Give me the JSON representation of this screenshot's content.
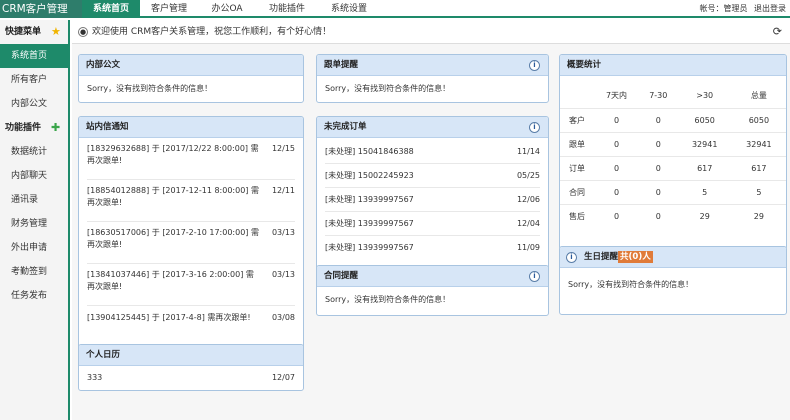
{
  "app": {
    "title": "CRM客户管理"
  },
  "nav": {
    "items": [
      {
        "label": "系统首页",
        "active": true
      },
      {
        "label": "客户管理"
      },
      {
        "label": "办公OA"
      },
      {
        "label": "功能插件"
      },
      {
        "label": "系统设置"
      }
    ],
    "account": "帐号：管理员",
    "logout": "退出登录"
  },
  "sidebar": {
    "quick_title": "快捷菜单",
    "quick_items": [
      {
        "label": "系统首页",
        "active": true
      },
      {
        "label": "所有客户"
      },
      {
        "label": "内部公文"
      }
    ],
    "plugin_title": "功能插件",
    "plugin_items": [
      {
        "label": "数据统计"
      },
      {
        "label": "内部聊天"
      },
      {
        "label": "通讯录"
      },
      {
        "label": "财务管理"
      },
      {
        "label": "外出申请"
      },
      {
        "label": "考勤签到"
      },
      {
        "label": "任务发布"
      }
    ]
  },
  "welcome": {
    "text": "欢迎使用 CRM客户关系管理，祝您工作顺利，有个好心情！"
  },
  "empty_msg": "Sorry，没有找到符合条件的信息！",
  "panels": {
    "docs": {
      "title": "内部公文"
    },
    "followup": {
      "title": "跟单提醒"
    },
    "messages": {
      "title": "站内信通知",
      "items": [
        {
          "text": "[18329632688] 于 [2017/12/22 8:00:00] 需再次跟单!",
          "date": "12/15"
        },
        {
          "text": "[18854012888] 于 [2017-12-11 8:00:00] 需再次跟单!",
          "date": "12/11"
        },
        {
          "text": "[18630517006] 于 [2017-2-10 17:00:00] 需再次跟单!",
          "date": "03/13"
        },
        {
          "text": "[13841037446] 于 [2017-3-16 2:00:00] 需再次跟单!",
          "date": "03/13"
        },
        {
          "text": "[13904125445] 于 [2017-4-8] 需再次跟单!",
          "date": "03/08"
        }
      ]
    },
    "orders": {
      "title": "未完成订单",
      "items": [
        {
          "text": "[未处理] 15041846388",
          "date": "11/14"
        },
        {
          "text": "[未处理] 15002245923",
          "date": "05/25"
        },
        {
          "text": "[未处理] 13939997567",
          "date": "12/06"
        },
        {
          "text": "[未处理] 13939997567",
          "date": "12/04"
        },
        {
          "text": "[未处理] 13939997567",
          "date": "11/09"
        }
      ]
    },
    "contracts": {
      "title": "合同提醒"
    },
    "calendar": {
      "title": "个人日历",
      "items": [
        {
          "text": "333",
          "date": "12/07"
        }
      ]
    },
    "stats": {
      "title": "概要统计",
      "headers": [
        "",
        "7天内",
        "7-30",
        ">30",
        "总量"
      ],
      "rows": [
        [
          "客户",
          "0",
          "0",
          "6050",
          "6050"
        ],
        [
          "跟单",
          "0",
          "0",
          "32941",
          "32941"
        ],
        [
          "订单",
          "0",
          "0",
          "617",
          "617"
        ],
        [
          "合同",
          "0",
          "0",
          "5",
          "5"
        ],
        [
          "售后",
          "0",
          "0",
          "29",
          "29"
        ]
      ]
    },
    "birthday": {
      "title": "生日提醒",
      "badge": "共(0)人"
    }
  },
  "colors": {
    "brand": "#2e7d6b",
    "accent": "#1e8a6a",
    "panel_header": "#d7e6f7",
    "badge": "#e07b39"
  }
}
